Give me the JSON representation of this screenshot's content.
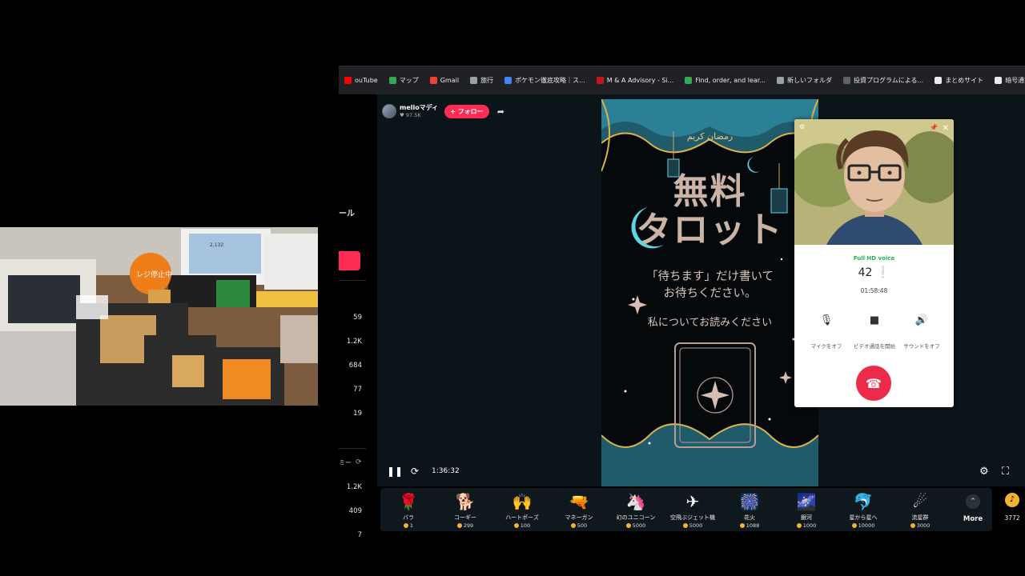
{
  "bookmarks": [
    {
      "label": "ouTube",
      "icon": "youtube-icon",
      "color": "#ff0000"
    },
    {
      "label": "マップ",
      "icon": "map-pin-icon",
      "color": "#34a853"
    },
    {
      "label": "Gmail",
      "icon": "gmail-icon",
      "color": "#ea4335"
    },
    {
      "label": "旅行",
      "icon": "folder-icon",
      "color": "#9aa0a6"
    },
    {
      "label": "ポケモン徹底攻略｜ス...",
      "icon": "pokemon-site-icon",
      "color": "#4285f4"
    },
    {
      "label": "M & A Advisory - Si...",
      "icon": "ma-advisory-icon",
      "color": "#c4161c"
    },
    {
      "label": "Find, order, and lear...",
      "icon": "find-order-icon",
      "color": "#34a853"
    },
    {
      "label": "新しいフォルダ",
      "icon": "folder-icon",
      "color": "#9aa0a6"
    },
    {
      "label": "投資プログラムによる...",
      "icon": "invest-icon",
      "color": "#5f6368"
    },
    {
      "label": "まとめサイト",
      "icon": "globe-icon",
      "color": "#e8eaed"
    },
    {
      "label": "暗号通貨デリバティブ...",
      "icon": "crypto-icon",
      "color": "#e8eaed"
    }
  ],
  "sidebar": {
    "heading": "ール",
    "numbers": [
      "59",
      "1.2K",
      "684",
      "77",
      "19"
    ],
    "partial_label": "ミー",
    "numbers2": [
      "1.2K",
      "409",
      "7"
    ]
  },
  "streamer": {
    "name": "melloマディ",
    "likes": "♥ 97.5K",
    "follow_label": "+ フォロー"
  },
  "poster": {
    "arabic": "رمضان كريم",
    "headline_1": "無料",
    "headline_2": "タロット",
    "sub_1": "「待ちます」だけ書いて",
    "sub_2": "お待ちください。",
    "sub_3": "私についてお読みください"
  },
  "player": {
    "elapsed": "1:36:32"
  },
  "call": {
    "quality": "Full HD voice",
    "participant": "42 ❕",
    "duration": "01:58:48",
    "options": [
      {
        "icon": "🎙",
        "label": "マイクをオフ"
      },
      {
        "icon": "■",
        "label": "ビデオ通話を開始"
      },
      {
        "icon": "🔊",
        "label": "サウンドをオフ"
      }
    ],
    "hangup_icon": "☎"
  },
  "gifts": [
    {
      "name": "バラ",
      "price": "1",
      "icon": "🌹",
      "icon_name": "rose-gift-icon"
    },
    {
      "name": "コーギー",
      "price": "299",
      "icon": "🐕",
      "icon_name": "corgi-gift-icon"
    },
    {
      "name": "ハートポーズ",
      "price": "100",
      "icon": "🙌",
      "icon_name": "heart-pose-gift-icon"
    },
    {
      "name": "マネーガン",
      "price": "500",
      "icon": "🔫",
      "icon_name": "money-gun-gift-icon"
    },
    {
      "name": "幻のユニコーン",
      "price": "5000",
      "icon": "🦄",
      "icon_name": "unicorn-gift-icon"
    },
    {
      "name": "空飛ぶジェット機",
      "price": "5000",
      "icon": "✈",
      "icon_name": "jet-gift-icon"
    },
    {
      "name": "花火",
      "price": "1088",
      "icon": "🎆",
      "icon_name": "fireworks-gift-icon"
    },
    {
      "name": "銀河",
      "price": "1000",
      "icon": "🌌",
      "icon_name": "galaxy-gift-icon"
    },
    {
      "name": "星から星へ",
      "price": "10000",
      "icon": "🐬",
      "icon_name": "star-to-star-gift-icon"
    },
    {
      "name": "流星群",
      "price": "3000",
      "icon": "☄",
      "icon_name": "meteor-shower-gift-icon"
    }
  ],
  "more_label": "More",
  "balance": "3772",
  "colors": {
    "accent": "#fe2c55",
    "hangup": "#ec2b4a",
    "hd_green": "#21b35a",
    "coin": "#f2b234"
  }
}
